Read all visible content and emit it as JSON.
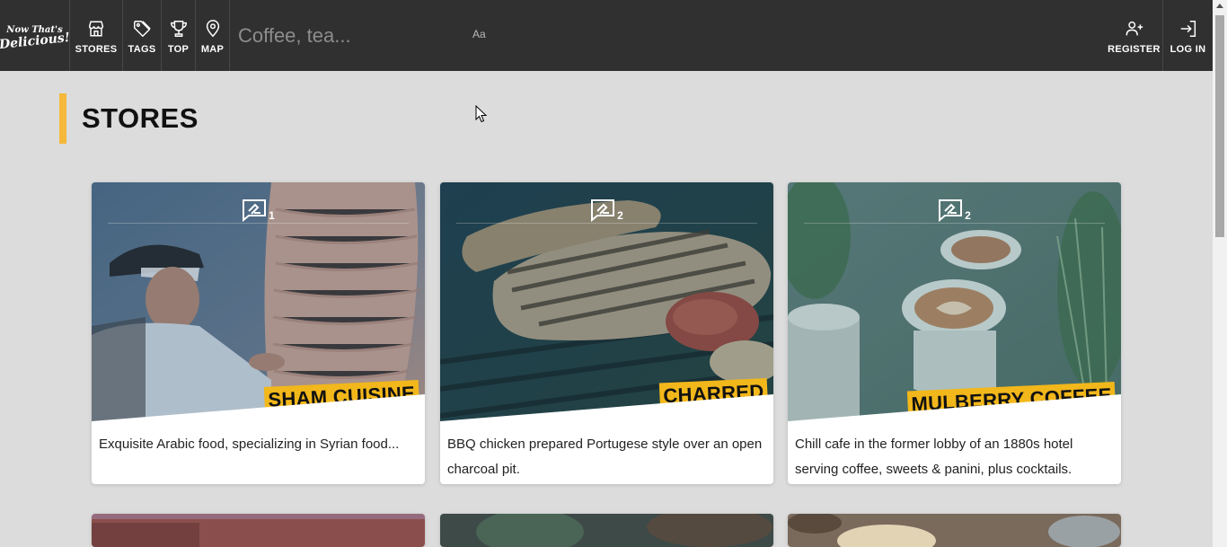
{
  "logo": {
    "line1": "Now That's",
    "line2": "Delicious!"
  },
  "nav": {
    "items": [
      {
        "label": "STORES",
        "icon": "store-icon"
      },
      {
        "label": "TAGS",
        "icon": "tag-icon"
      },
      {
        "label": "TOP",
        "icon": "trophy-icon"
      },
      {
        "label": "MAP",
        "icon": "map-pin-icon"
      }
    ],
    "search_placeholder": "Coffee, tea...",
    "search_aa": "Aa",
    "register_label": "REGISTER",
    "login_label": "LOG IN"
  },
  "page": {
    "title": "STORES"
  },
  "colors": {
    "accent": "#f6b83a",
    "banner": "#f2b71a",
    "nav_bg": "#303030",
    "page_bg": "#dcdcdc"
  },
  "stores": [
    {
      "name": "SHAM CUISINE",
      "review_count": "1",
      "description": "Exquisite Arabic food, specializing in Syrian food..."
    },
    {
      "name": "CHARRED",
      "review_count": "2",
      "description": "BBQ chicken prepared Portugese style over an open charcoal pit."
    },
    {
      "name": "MULBERRY COFFEE",
      "review_count": "2",
      "description": "Chill cafe in the former lobby of an 1880s hotel serving coffee, sweets & panini, plus cocktails."
    }
  ]
}
